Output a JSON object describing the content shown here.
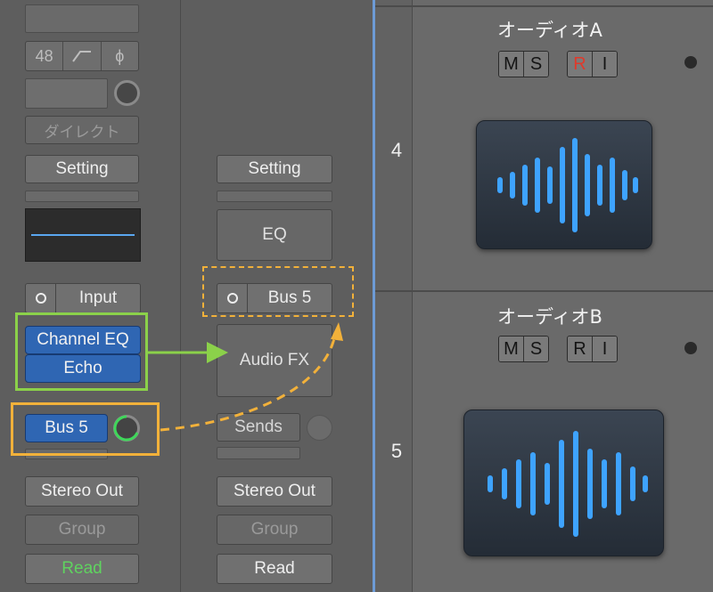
{
  "strip1": {
    "input_format": "48",
    "hpf_icon": "highpass-filter-icon",
    "phase_icon": "phase-invert-icon",
    "direct_label": "ダイレクト",
    "setting_label": "Setting",
    "input_label": "Input",
    "plugins": [
      "Channel EQ",
      "Echo"
    ],
    "send_label": "Bus 5",
    "output_label": "Stereo Out",
    "group_label": "Group",
    "automation_label": "Read"
  },
  "strip2": {
    "setting_label": "Setting",
    "eq_label": "EQ",
    "input_label": "Bus 5",
    "audio_fx_label": "Audio FX",
    "sends_label": "Sends",
    "output_label": "Stereo Out",
    "group_label": "Group",
    "automation_label": "Read"
  },
  "tracks": [
    {
      "number": "4",
      "name": "オーディオA",
      "buttons": [
        "M",
        "S",
        "R",
        "I"
      ],
      "record_armed": true
    },
    {
      "number": "5",
      "name": "オーディオB",
      "buttons": [
        "M",
        "S",
        "R",
        "I"
      ],
      "record_armed": false
    }
  ],
  "colors": {
    "highlight_green": "#8bd14a",
    "highlight_orange": "#f2b13a",
    "plugin_blue": "#2f66b3",
    "waveform_blue": "#3ea3ff",
    "record_red": "#e0392b",
    "read_green": "#5fd35f"
  }
}
